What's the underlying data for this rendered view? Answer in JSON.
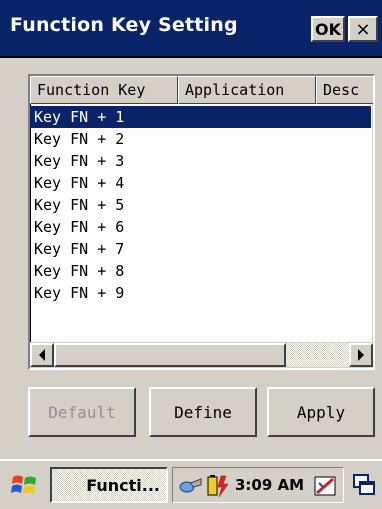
{
  "window": {
    "title": "Function Key Setting",
    "ok_label": "OK",
    "close_label": "×"
  },
  "list": {
    "columns": [
      "Function Key",
      "Application",
      "Desc"
    ],
    "rows": [
      "Key FN + 1",
      "Key FN + 2",
      "Key FN + 3",
      "Key FN + 4",
      "Key FN + 5",
      "Key FN + 6",
      "Key FN + 7",
      "Key FN + 8",
      "Key FN + 9"
    ],
    "selected_index": 0
  },
  "buttons": {
    "default_label": "Default",
    "define_label": "Define",
    "apply_label": "Apply"
  },
  "taskbar": {
    "task_label": "Functi...",
    "clock": "3:09 AM",
    "icons": [
      "start-windows-icon",
      "network-icon",
      "battery-icon",
      "input-panel-icon",
      "desktop-icon"
    ]
  },
  "colors": {
    "titlebar": "#0a246a",
    "selection": "#0a246a",
    "face": "#d4d0c8"
  }
}
